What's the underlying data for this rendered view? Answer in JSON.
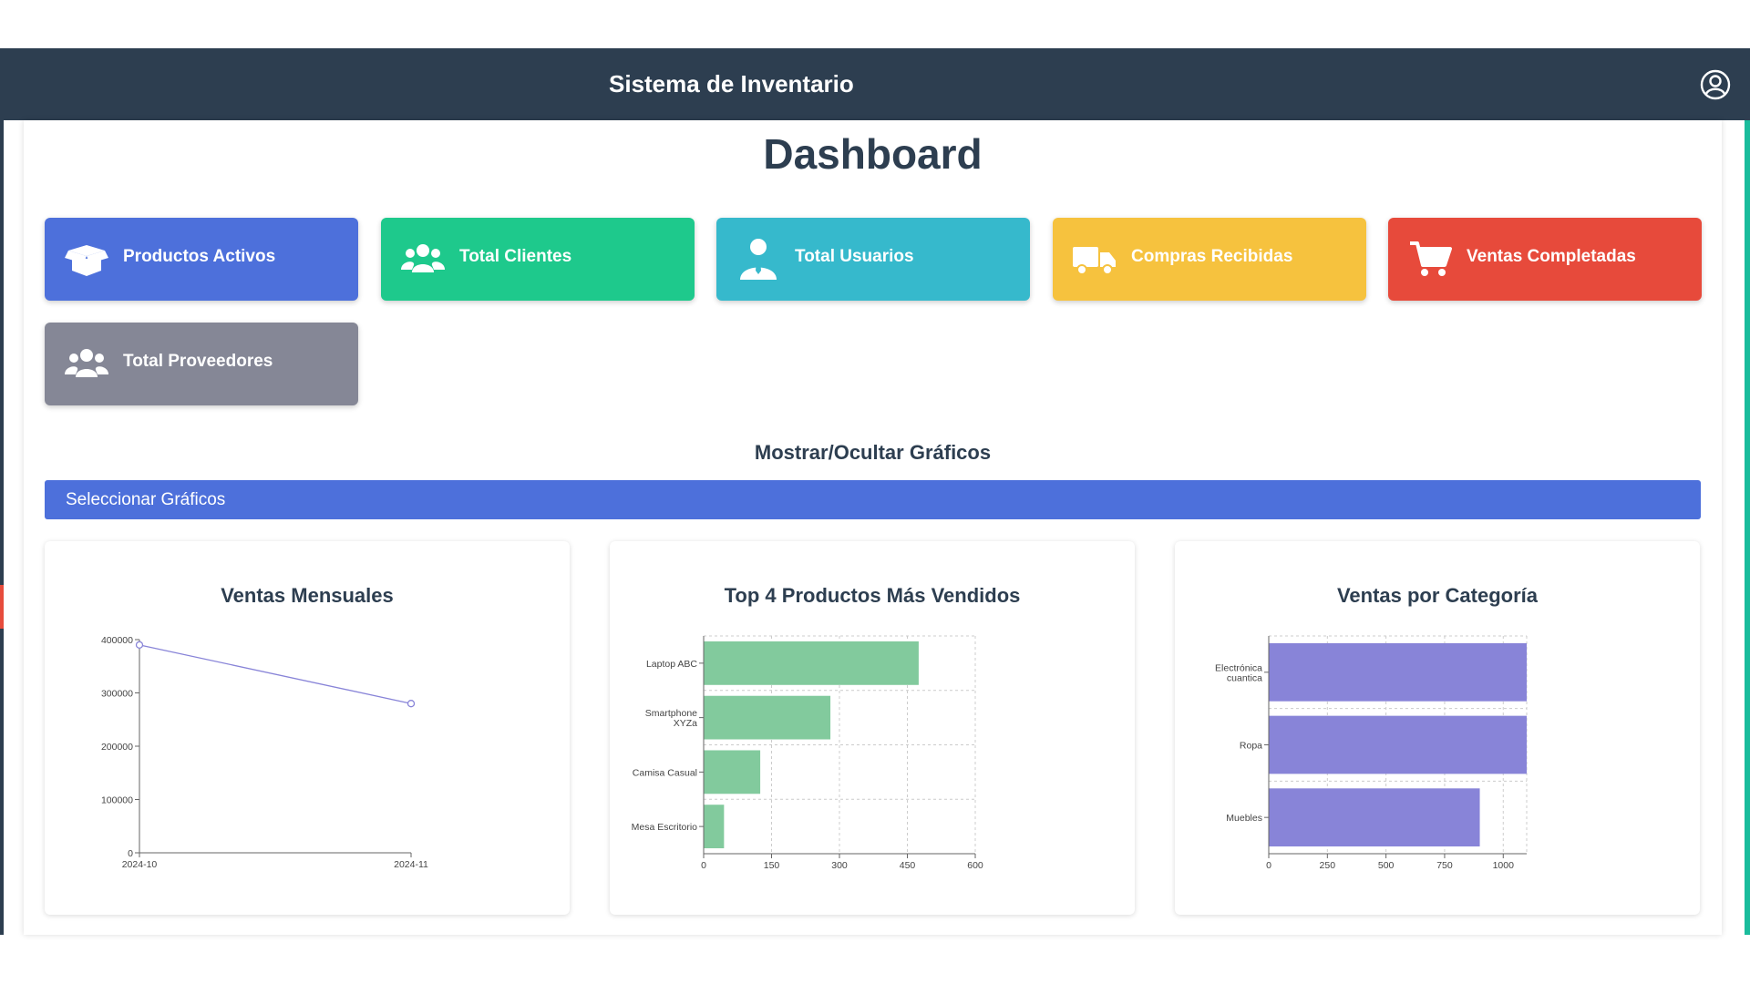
{
  "header": {
    "title": "Sistema de Inventario",
    "user_icon": "user-circle-icon"
  },
  "dashboard": {
    "title": "Dashboard"
  },
  "cards": [
    {
      "label": "Productos Activos",
      "icon": "box-open-icon",
      "color": "#4d70db"
    },
    {
      "label": "Total Clientes",
      "icon": "users-icon",
      "color": "#1ec98c"
    },
    {
      "label": "Total Usuarios",
      "icon": "user-tie-icon",
      "color": "#36b9cc"
    },
    {
      "label": "Compras Recibidas",
      "icon": "truck-icon",
      "color": "#f6c23e"
    },
    {
      "label": "Ventas Completadas",
      "icon": "cart-icon",
      "color": "#e74a3b"
    },
    {
      "label": "Total Proveedores",
      "icon": "users-icon",
      "color": "#858796"
    }
  ],
  "charts_section": {
    "title": "Mostrar/Ocultar Gráficos",
    "select_label": "Seleccionar Gráficos"
  },
  "chart_data": [
    {
      "type": "line",
      "title": "Ventas Mensuales",
      "x": [
        "2024-10",
        "2024-11"
      ],
      "series": [
        {
          "values": [
            390000,
            280000
          ],
          "color": "#8884d8"
        }
      ],
      "ylim": [
        0,
        400000
      ],
      "yticks": [
        0,
        100000,
        200000,
        300000,
        400000
      ],
      "grid": false
    },
    {
      "type": "bar",
      "orientation": "horizontal",
      "title": "Top 4 Productos Más Vendidos",
      "categories": [
        "Laptop ABC",
        "Smartphone XYZa",
        "Camisa Casual",
        "Mesa Escritorio"
      ],
      "category_lines": [
        [
          "Laptop ABC"
        ],
        [
          "Smartphone",
          "XYZa"
        ],
        [
          "Camisa Casual"
        ],
        [
          "Mesa Escritorio"
        ]
      ],
      "values": [
        475,
        280,
        125,
        45
      ],
      "color": "#82ca9d",
      "xlim": [
        0,
        600
      ],
      "xticks": [
        0,
        150,
        300,
        450,
        600
      ],
      "grid": true
    },
    {
      "type": "bar",
      "orientation": "horizontal",
      "title": "Ventas por Categoría",
      "categories": [
        "Electrónica cuantica",
        "Ropa",
        "Muebles"
      ],
      "category_lines": [
        [
          "Electrónica",
          "cuantica"
        ],
        [
          "Ropa"
        ],
        [
          "Muebles"
        ]
      ],
      "values": [
        1100,
        1100,
        900
      ],
      "color": "#8884d8",
      "xlim": [
        0,
        1100
      ],
      "xticks": [
        0,
        250,
        500,
        750,
        1000
      ],
      "grid": true
    }
  ]
}
